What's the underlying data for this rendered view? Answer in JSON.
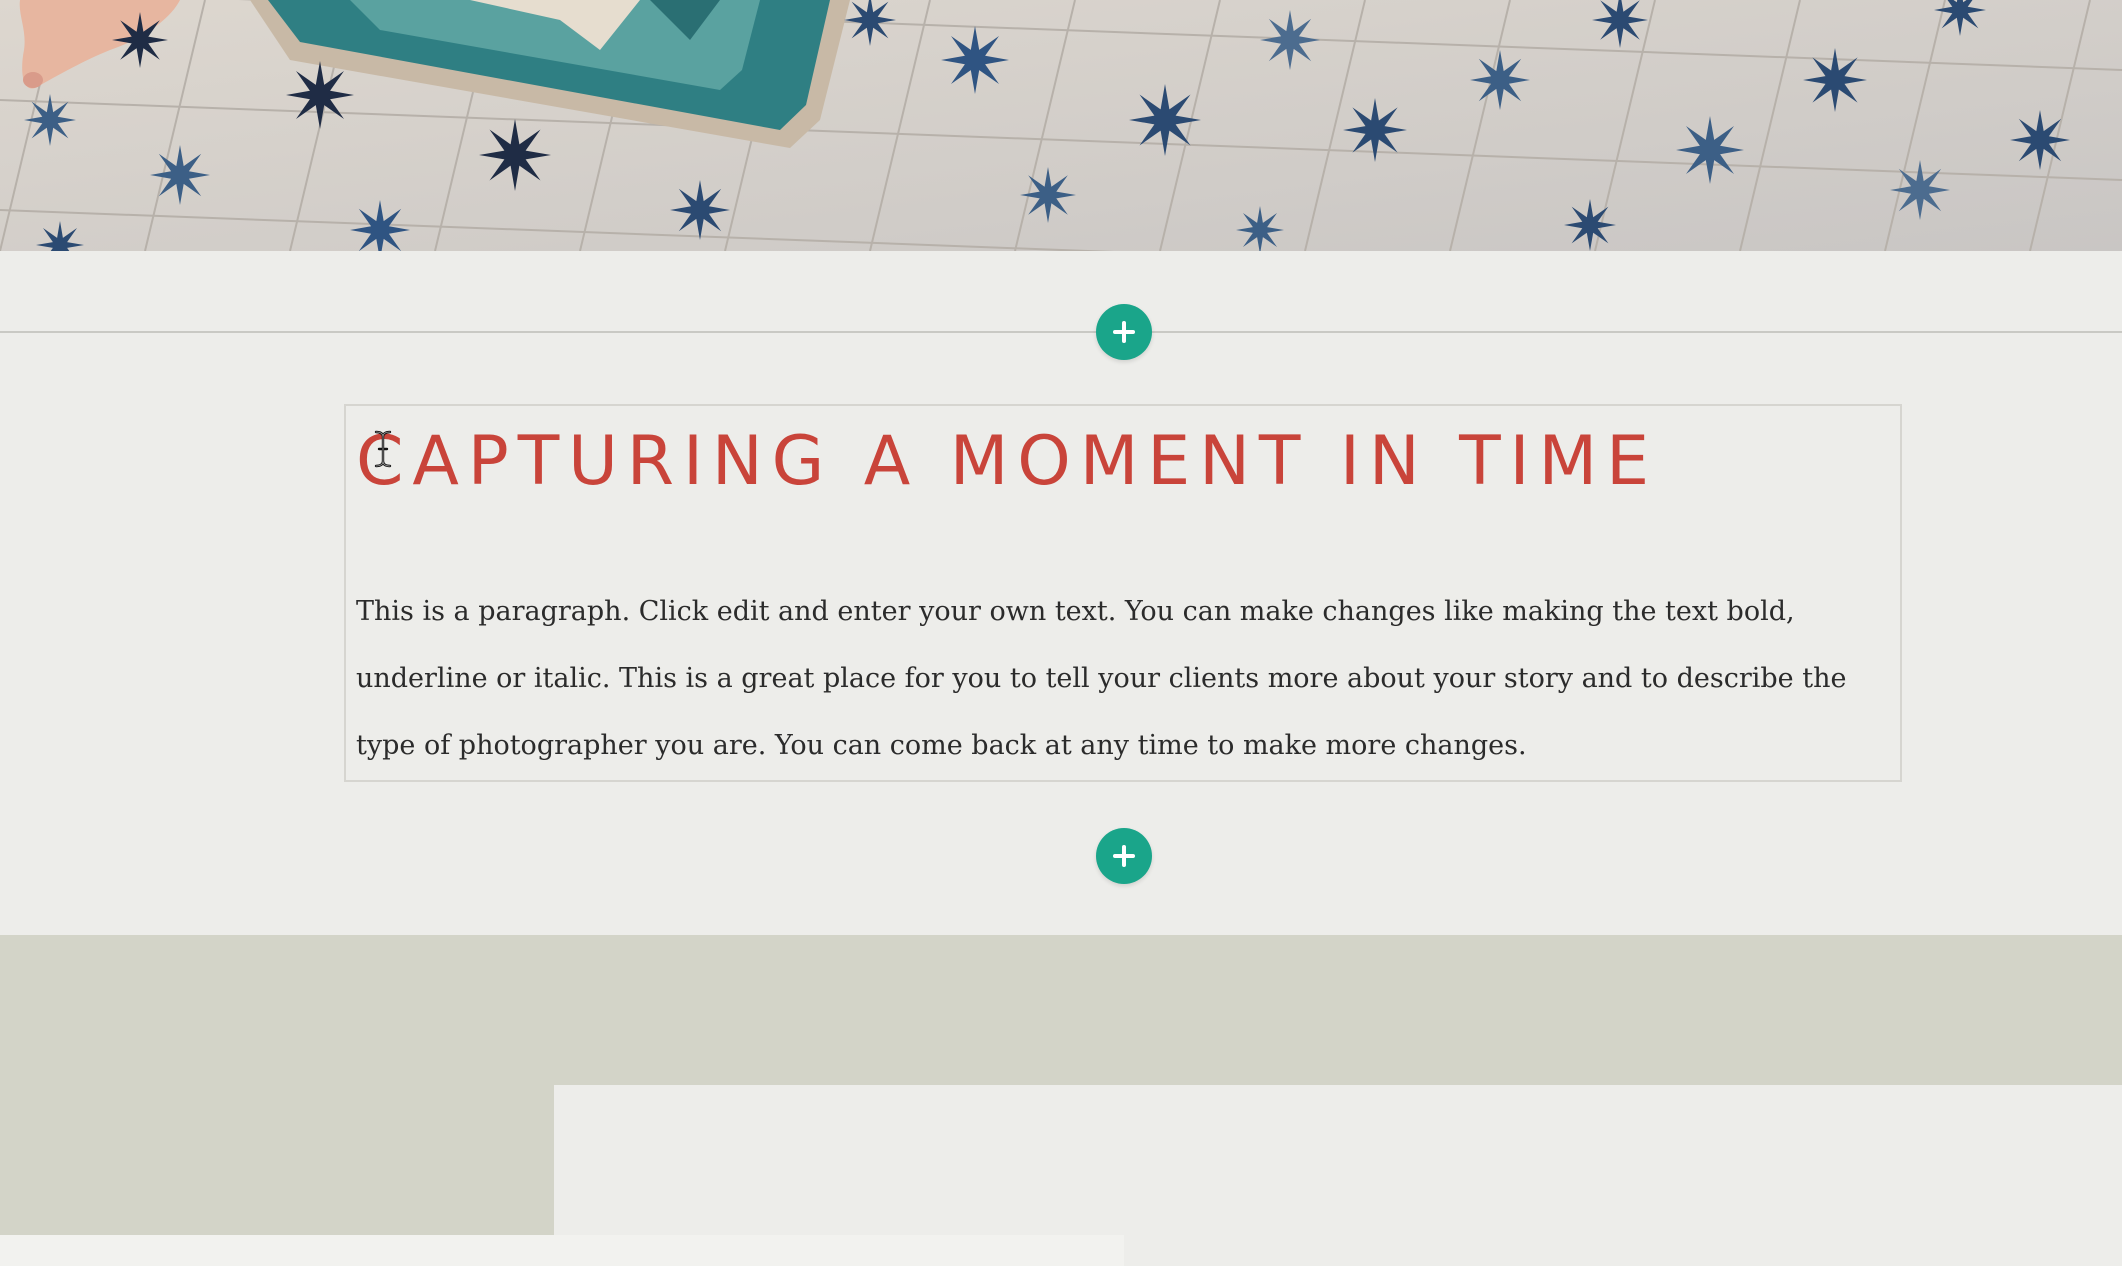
{
  "hero": {
    "image_name": "tile-floor-photo"
  },
  "add_section": {
    "icon": "plus-icon",
    "color": "#1aa58a"
  },
  "text_block": {
    "heading": "CAPTURING A MOMENT IN TIME",
    "heading_color": "#c9443a",
    "paragraph": "This is a paragraph. Click edit and enter your own text. You can make changes like making the text bold, underline or italic. This is a great place for you to tell your clients more about your story and to describe the type of photographer you are. You can come back at any time to make more changes."
  },
  "colors": {
    "page_background": "#ededea",
    "lower_section_background": "#d3d4c8"
  }
}
